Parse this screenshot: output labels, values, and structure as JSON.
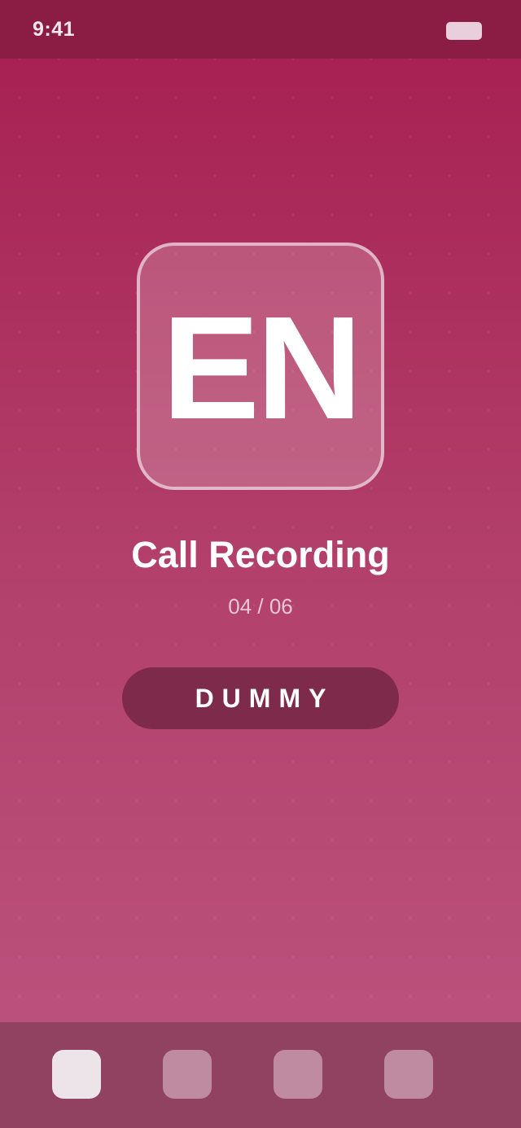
{
  "status_bar": {
    "time": "9:41",
    "battery_icon": "battery-icon"
  },
  "main": {
    "icon_text": "EN",
    "title": "Call Recording",
    "page_counter": "04 / 06",
    "button_label": "DUMMY"
  },
  "dock": {
    "items": [
      {
        "icon": "app-icon-1",
        "active": true
      },
      {
        "icon": "app-icon-2",
        "active": false
      },
      {
        "icon": "app-icon-3",
        "active": false
      },
      {
        "icon": "app-icon-4",
        "active": false
      }
    ]
  },
  "colors": {
    "status_bar": "#8b1c43",
    "background_top": "#a61e4f",
    "background_bottom": "#bc5580",
    "button": "#7e2a4a",
    "dock": "#914261"
  }
}
